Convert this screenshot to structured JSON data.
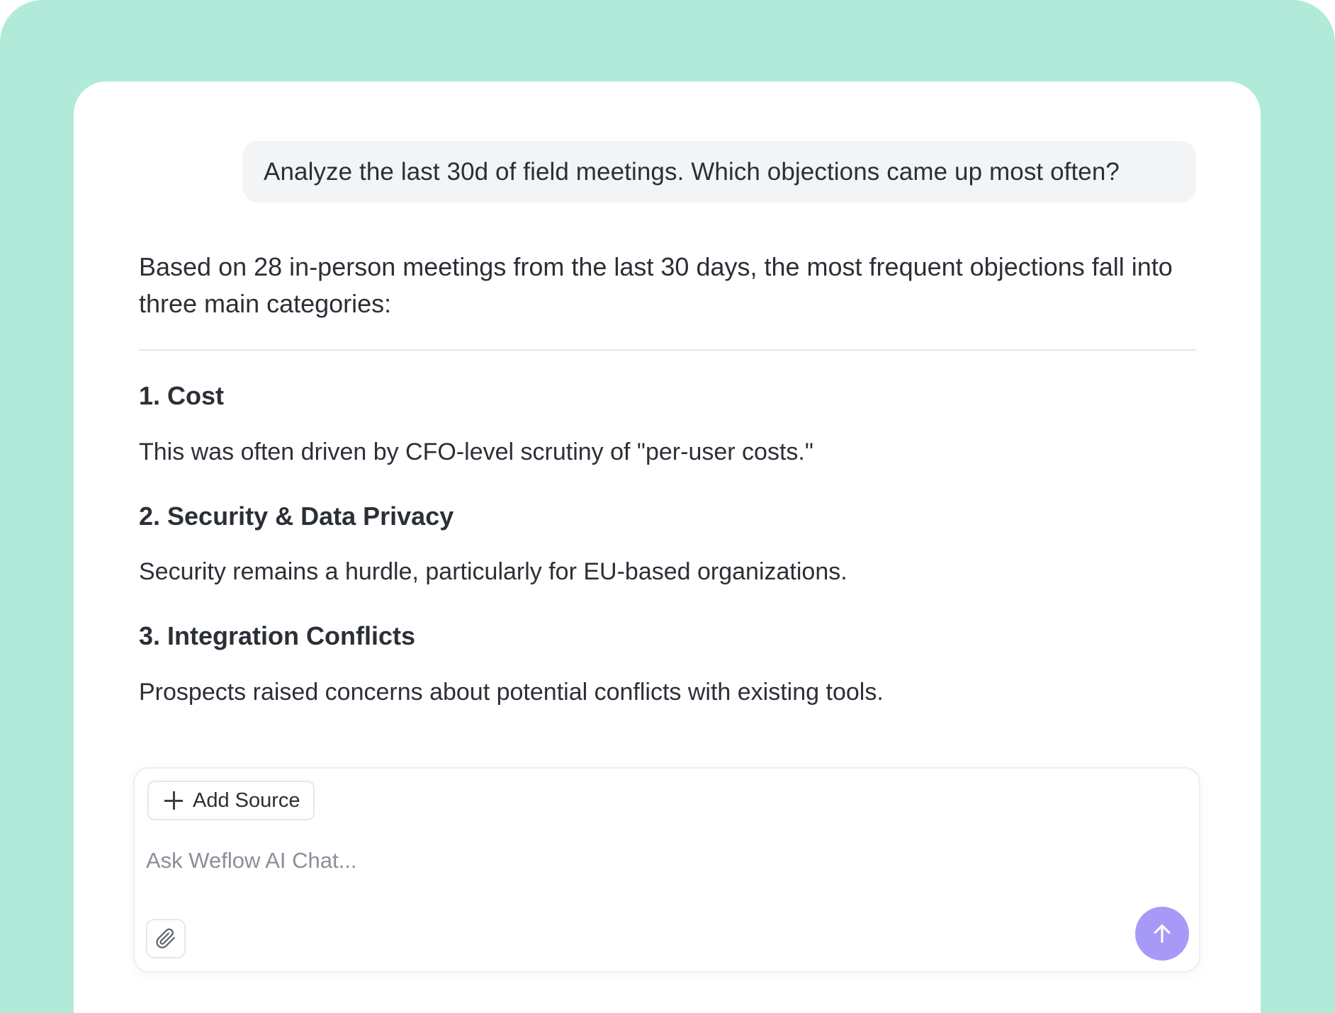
{
  "conversation": {
    "user_message": "Analyze the last 30d of field meetings. Which objections came up most often?",
    "answer_intro": "Based on 28 in-person meetings from the last 30 days, the most frequent objections fall into three main categories:",
    "sections": [
      {
        "heading": "1. Cost",
        "body": "This was often driven by CFO-level scrutiny of \"per-user costs.\""
      },
      {
        "heading": "2. Security & Data Privacy",
        "body": "Security remains a hurdle, particularly for EU-based organizations."
      },
      {
        "heading": "3. Integration Conflicts",
        "body": "Prospects raised concerns about potential conflicts with existing tools."
      }
    ]
  },
  "composer": {
    "add_source_label": "Add Source",
    "add_source_icon": "plus-icon",
    "input_placeholder": "Ask Weflow AI Chat...",
    "input_value": "",
    "attach_icon": "paperclip-icon",
    "send_icon": "arrow-up-icon"
  },
  "colors": {
    "background": "#b2eada",
    "card": "#ffffff",
    "user_bubble": "#f3f4f6",
    "text": "#2b2f36",
    "send_button": "#a79af7"
  }
}
